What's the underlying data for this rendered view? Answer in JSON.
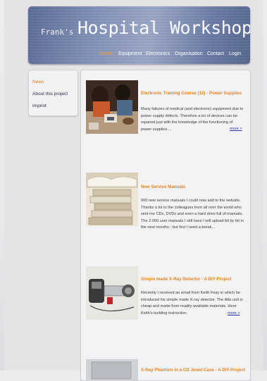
{
  "header": {
    "logo_small": "Frank's",
    "logo_big": "Hospital Workshop",
    "nav": [
      "Home",
      "Equipment",
      "Electronics",
      "Organisation",
      "Contact",
      "Login"
    ]
  },
  "sidebar": {
    "items": [
      "News",
      "About this project",
      "Imprint"
    ]
  },
  "articles": [
    {
      "title": "Electronic Training Course (12) - Power Supplies",
      "lines": [
        "Many failures of medical (and electronic) equipment due to",
        "power supply defects. Therefore a lot of devices can be",
        "repaired just with the knowledge of the functioning of",
        "power supplies...."
      ],
      "more": "more >"
    },
    {
      "title": "New Service Manuals",
      "lines": [
        "900 new service manuals I could now add to the website.",
        "Thanks a lot to the colleagues from all over the world who",
        "sent me CDs, DVDs and even a hard drive full of manuals.",
        "The 2.000 user manuals I still have I will upload bit by bit in",
        "the next months - but first I need a break..."
      ]
    },
    {
      "title": "Simple made X-Ray Detector - A DIY-Project",
      "lines": [
        "Recently I received an email from Keith Feay in which he",
        "introduced his simple made X-ray detector. The little unit is",
        "cheap and made from readily available materials. Here",
        "Keith's building instruction."
      ],
      "more": "more >"
    },
    {
      "title": "X-Ray Phantom in a CD Jewel Case - A DIY-Project"
    }
  ],
  "colors": {
    "accent": "#e8821e",
    "nav_active": "#f5a032",
    "header": "#7b8bb3"
  }
}
